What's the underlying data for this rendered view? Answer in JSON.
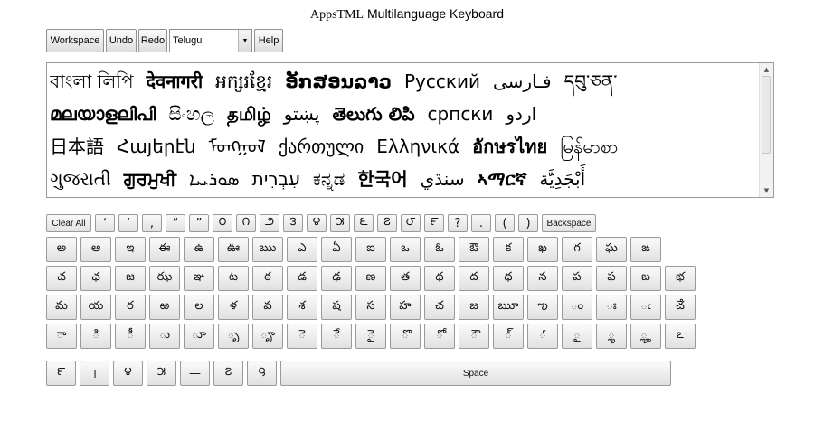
{
  "title": {
    "brand": "AppsTML",
    "rest": " Multilanguage Keyboard"
  },
  "toolbar": {
    "workspace": "Workspace",
    "undo": "Undo",
    "redo": "Redo",
    "language_selected": "Telugu",
    "help": "Help"
  },
  "textarea": {
    "line1": [
      "বাংলা লিপি",
      "देवनागरी",
      "អក្សរខ្មែរ",
      "ອັກສອນລາວ",
      "Русский",
      "فـارسی",
      "དབུ་ཅན་"
    ],
    "line2": [
      "മലയാളലിപി",
      "සිංහල",
      "தமிழ்",
      "پښتو",
      "తెలుగు లిపి",
      "српски",
      "اردو"
    ],
    "line3": [
      "日本語",
      "Հայերէն",
      "ᠮᠣᠩᠭᠣᠯ",
      "ქართული",
      "Ελληνικά",
      "อักษรไทย",
      "မြန်မာစာ"
    ],
    "line4": [
      "ગુજરાતી",
      "ਗੁਰਮੁਖੀ",
      "ܣܘܪܝܝܐ",
      "עִבְרִית",
      "ಕನ್ನಡ",
      "한국어",
      "سنڌي",
      "ኣማርኛ",
      "أَبْجَدِيَّة"
    ]
  },
  "keyboard": {
    "row0": [
      "Clear All",
      "‘",
      "’",
      ",",
      "“",
      "”",
      "౦",
      "౧",
      "౨",
      "౩",
      "౪",
      "౫",
      "౬",
      "౭",
      "౮",
      "౯",
      "?",
      ".",
      "(",
      ")",
      "Backspace"
    ],
    "row1": [
      "అ",
      "ఆ",
      "ఇ",
      "ఈ",
      "ఉ",
      "ఊ",
      "ఋ",
      "ఎ",
      "ఏ",
      "ఐ",
      "ఒ",
      "ఓ",
      "ఔ",
      "క",
      "ఖ",
      "గ",
      "ఘ",
      "ఙ"
    ],
    "row2": [
      "చ",
      "ఛ",
      "జ",
      "ఝ",
      "ఞ",
      "ట",
      "ఠ",
      "డ",
      "ఢ",
      "ణ",
      "త",
      "థ",
      "ద",
      "ధ",
      "న",
      "ప",
      "ఫ",
      "బ",
      "భ"
    ],
    "row3": [
      "మ",
      "య",
      "ర",
      "ఱ",
      "ల",
      "ళ",
      "వ",
      "శ",
      "ష",
      "స",
      "హ",
      "చ",
      "జ",
      "ౠ",
      "ఌ",
      "ం",
      "ః",
      "ఁ",
      "ౘ"
    ],
    "row4": [
      "ా",
      "ి",
      "ీ",
      "ు",
      "ూ",
      "ృ",
      "ౄ",
      "ె",
      "ే",
      "ై",
      "ొ",
      "ో",
      "ౌ",
      "్",
      "ౕ",
      "ౖ",
      "ౢ",
      "ౣ",
      "ఽ"
    ],
    "row5": [
      "౯",
      "।",
      "౪",
      "౫",
      "—",
      "౭",
      "౸"
    ],
    "space": "Space"
  }
}
